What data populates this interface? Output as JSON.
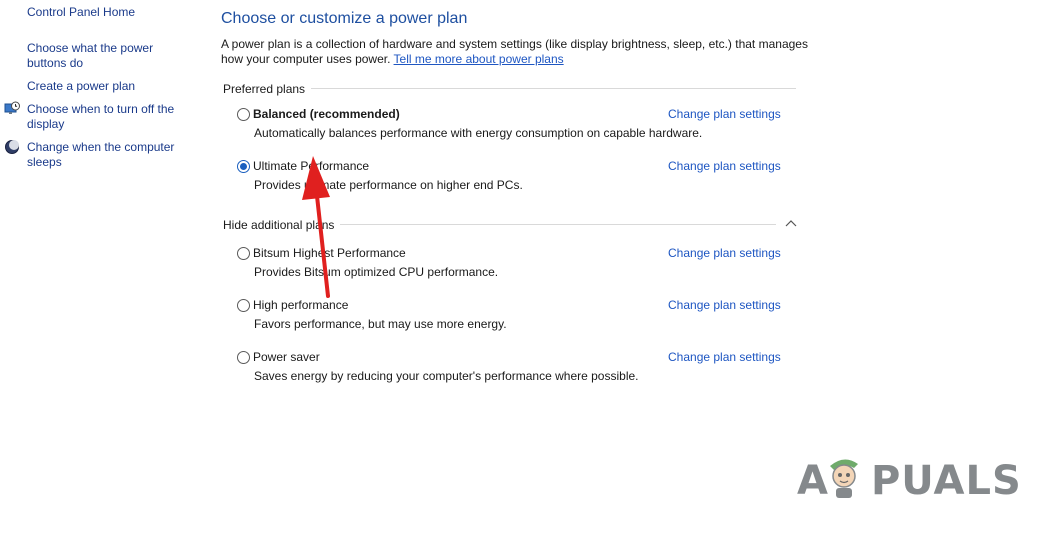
{
  "sidebar": {
    "items": [
      {
        "label": "Control Panel Home",
        "icon": null
      },
      {
        "label": "Choose what the power buttons do",
        "icon": null
      },
      {
        "label": "Create a power plan",
        "icon": null
      },
      {
        "label": "Choose when to turn off the display",
        "icon": "monitor-clock-icon"
      },
      {
        "label": "Change when the computer sleeps",
        "icon": "moon-icon"
      }
    ]
  },
  "main": {
    "title": "Choose or customize a power plan",
    "description": "A power plan is a collection of hardware and system settings (like display brightness, sleep, etc.) that manages how your computer uses power.",
    "learn_more_link": "Tell me more about power plans",
    "preferred_label": "Preferred plans",
    "hide_additional_label": "Hide additional plans",
    "change_link_label": "Change plan settings",
    "plans": [
      {
        "name": "Balanced (recommended)",
        "description": "Automatically balances performance with energy consumption on capable hardware.",
        "selected": false,
        "bold": true
      },
      {
        "name": "Ultimate Performance",
        "description": "Provides ultimate performance on higher end PCs.",
        "selected": true,
        "bold": false
      },
      {
        "name": "Bitsum Highest Performance",
        "description": "Provides Bitsum optimized CPU performance.",
        "selected": false,
        "bold": false
      },
      {
        "name": "High performance",
        "description": "Favors performance, but may use more energy.",
        "selected": false,
        "bold": false
      },
      {
        "name": "Power saver",
        "description": "Saves energy by reducing your computer's performance where possible.",
        "selected": false,
        "bold": false
      }
    ]
  },
  "watermark": {
    "text_left": "A",
    "text_right": "PUALS"
  },
  "colors": {
    "link": "#1e56c2",
    "title": "#1e4fa0",
    "arrow": "#e0201f",
    "radio_selected": "#1a5fbf"
  }
}
